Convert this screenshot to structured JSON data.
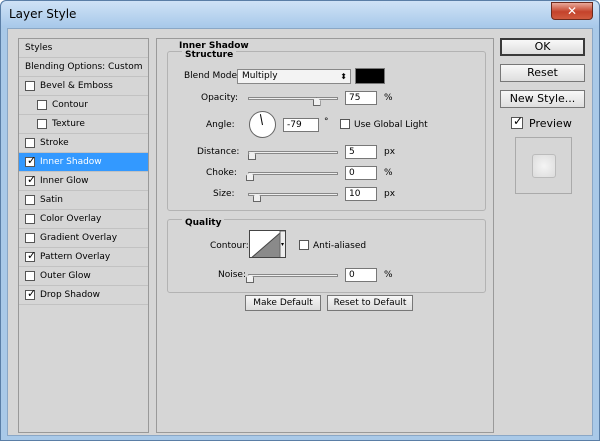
{
  "window": {
    "title": "Layer Style",
    "close_label": "✕"
  },
  "styles_list": {
    "header": "Styles",
    "blending": "Blending Options: Custom",
    "items": [
      {
        "label": "Bevel & Emboss",
        "checked": false,
        "indent": false,
        "selected": false
      },
      {
        "label": "Contour",
        "checked": false,
        "indent": true,
        "selected": false
      },
      {
        "label": "Texture",
        "checked": false,
        "indent": true,
        "selected": false
      },
      {
        "label": "Stroke",
        "checked": false,
        "indent": false,
        "selected": false
      },
      {
        "label": "Inner Shadow",
        "checked": true,
        "indent": false,
        "selected": true
      },
      {
        "label": "Inner Glow",
        "checked": true,
        "indent": false,
        "selected": false
      },
      {
        "label": "Satin",
        "checked": false,
        "indent": false,
        "selected": false
      },
      {
        "label": "Color Overlay",
        "checked": false,
        "indent": false,
        "selected": false
      },
      {
        "label": "Gradient Overlay",
        "checked": false,
        "indent": false,
        "selected": false
      },
      {
        "label": "Pattern Overlay",
        "checked": true,
        "indent": false,
        "selected": false
      },
      {
        "label": "Outer Glow",
        "checked": false,
        "indent": false,
        "selected": false
      },
      {
        "label": "Drop Shadow",
        "checked": true,
        "indent": false,
        "selected": false
      }
    ]
  },
  "inner_shadow": {
    "section_title": "Inner Shadow",
    "structure_title": "Structure",
    "blend_mode_label": "Blend Mode:",
    "blend_mode_value": "Multiply",
    "blend_color": "#000000",
    "opacity_label": "Opacity:",
    "opacity_value": "75",
    "opacity_unit": "%",
    "angle_label": "Angle:",
    "angle_value": "-79",
    "angle_unit": "°",
    "use_global_light_label": "Use Global Light",
    "use_global_light_checked": false,
    "distance_label": "Distance:",
    "distance_value": "5",
    "distance_unit": "px",
    "choke_label": "Choke:",
    "choke_value": "0",
    "choke_unit": "%",
    "size_label": "Size:",
    "size_value": "10",
    "size_unit": "px",
    "quality_title": "Quality",
    "contour_label": "Contour:",
    "anti_aliased_label": "Anti-aliased",
    "anti_aliased_checked": false,
    "noise_label": "Noise:",
    "noise_value": "0",
    "noise_unit": "%",
    "make_default_label": "Make Default",
    "reset_default_label": "Reset to Default"
  },
  "actions": {
    "ok_label": "OK",
    "reset_label": "Reset",
    "new_style_label": "New Style...",
    "preview_label": "Preview",
    "preview_checked": true
  }
}
